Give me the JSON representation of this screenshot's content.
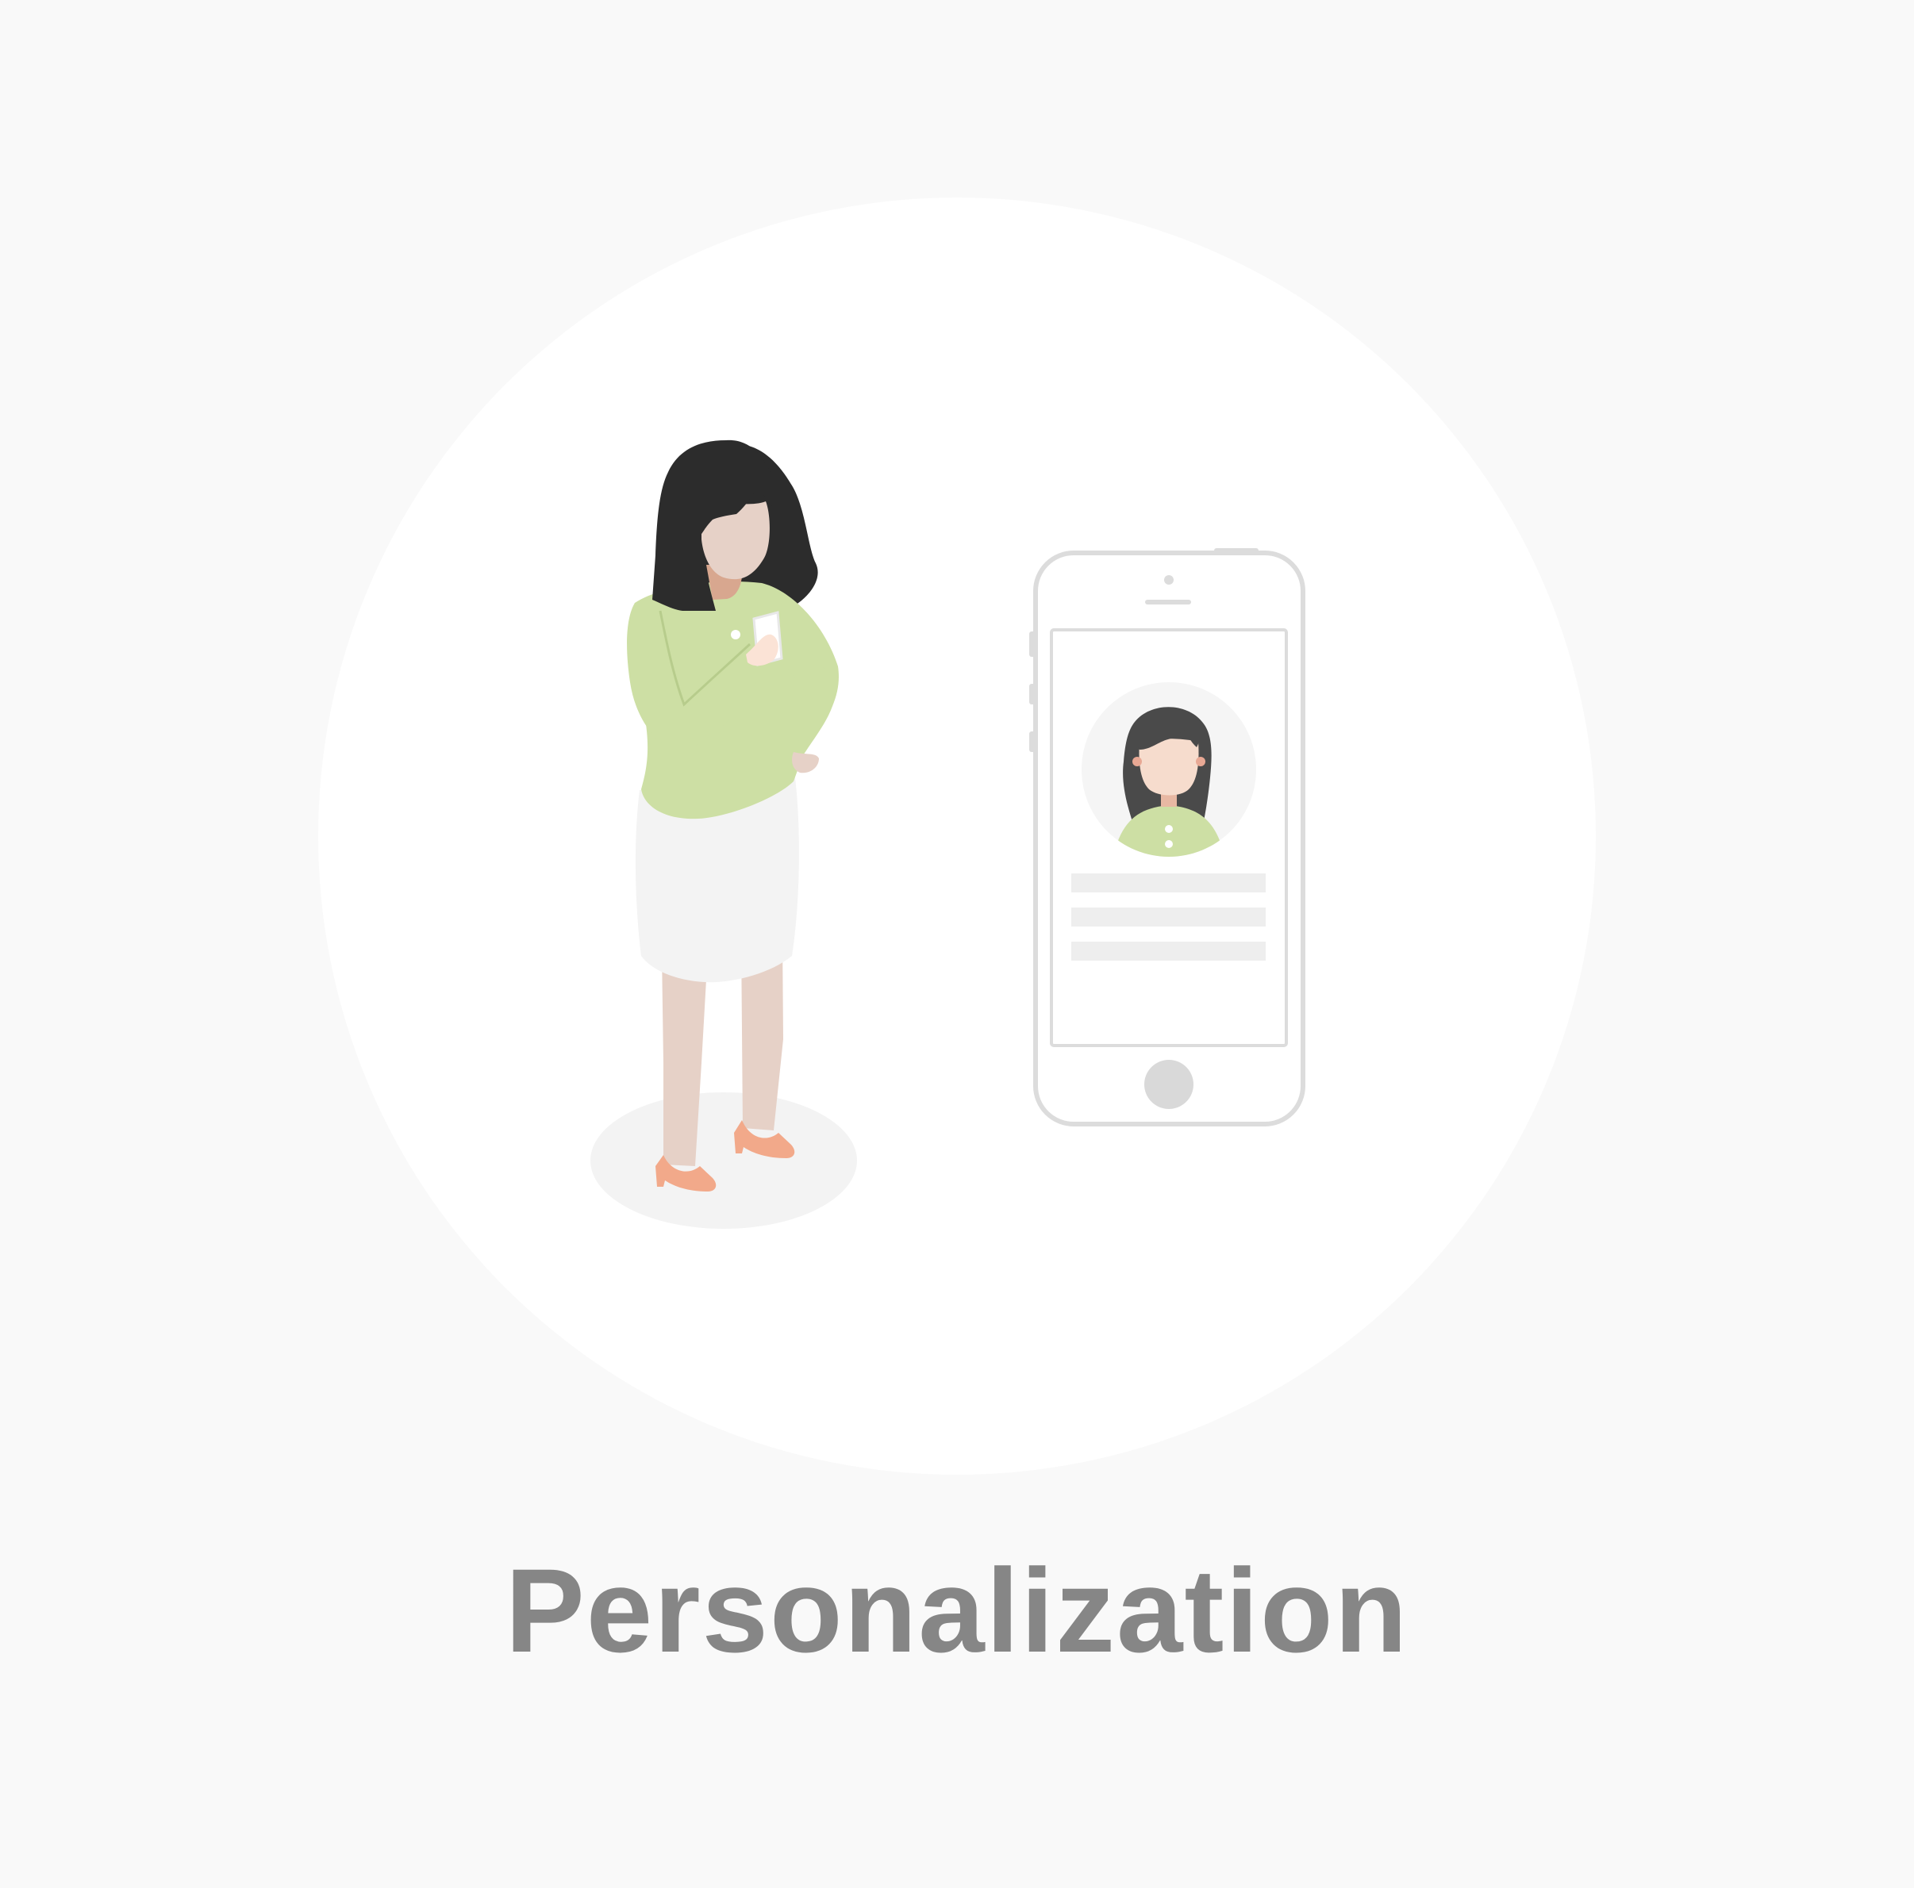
{
  "caption": "Personalization",
  "colors": {
    "page_background": "#f9f9f9",
    "circle_background": "#ffffff",
    "caption_text": "#868686",
    "hair": "#2c2c2c",
    "skin": "#e6d1c7",
    "sweater": "#cddfa4",
    "skirt": "#f3f3f3",
    "shoes": "#f2a98a",
    "phone_outline": "#dcdcdc",
    "avatar_bg": "#f5f5f5",
    "avatar_hair": "#4a4a4a",
    "avatar_skin": "#f6dccd",
    "avatar_sweater": "#cddfa4",
    "home_button": "#d9d9d9",
    "placeholder_line": "#eeeeee"
  },
  "illustration": {
    "figure": "woman-holding-phone",
    "device": "smartphone-profile-screen",
    "profile_placeholder_lines": 3
  }
}
